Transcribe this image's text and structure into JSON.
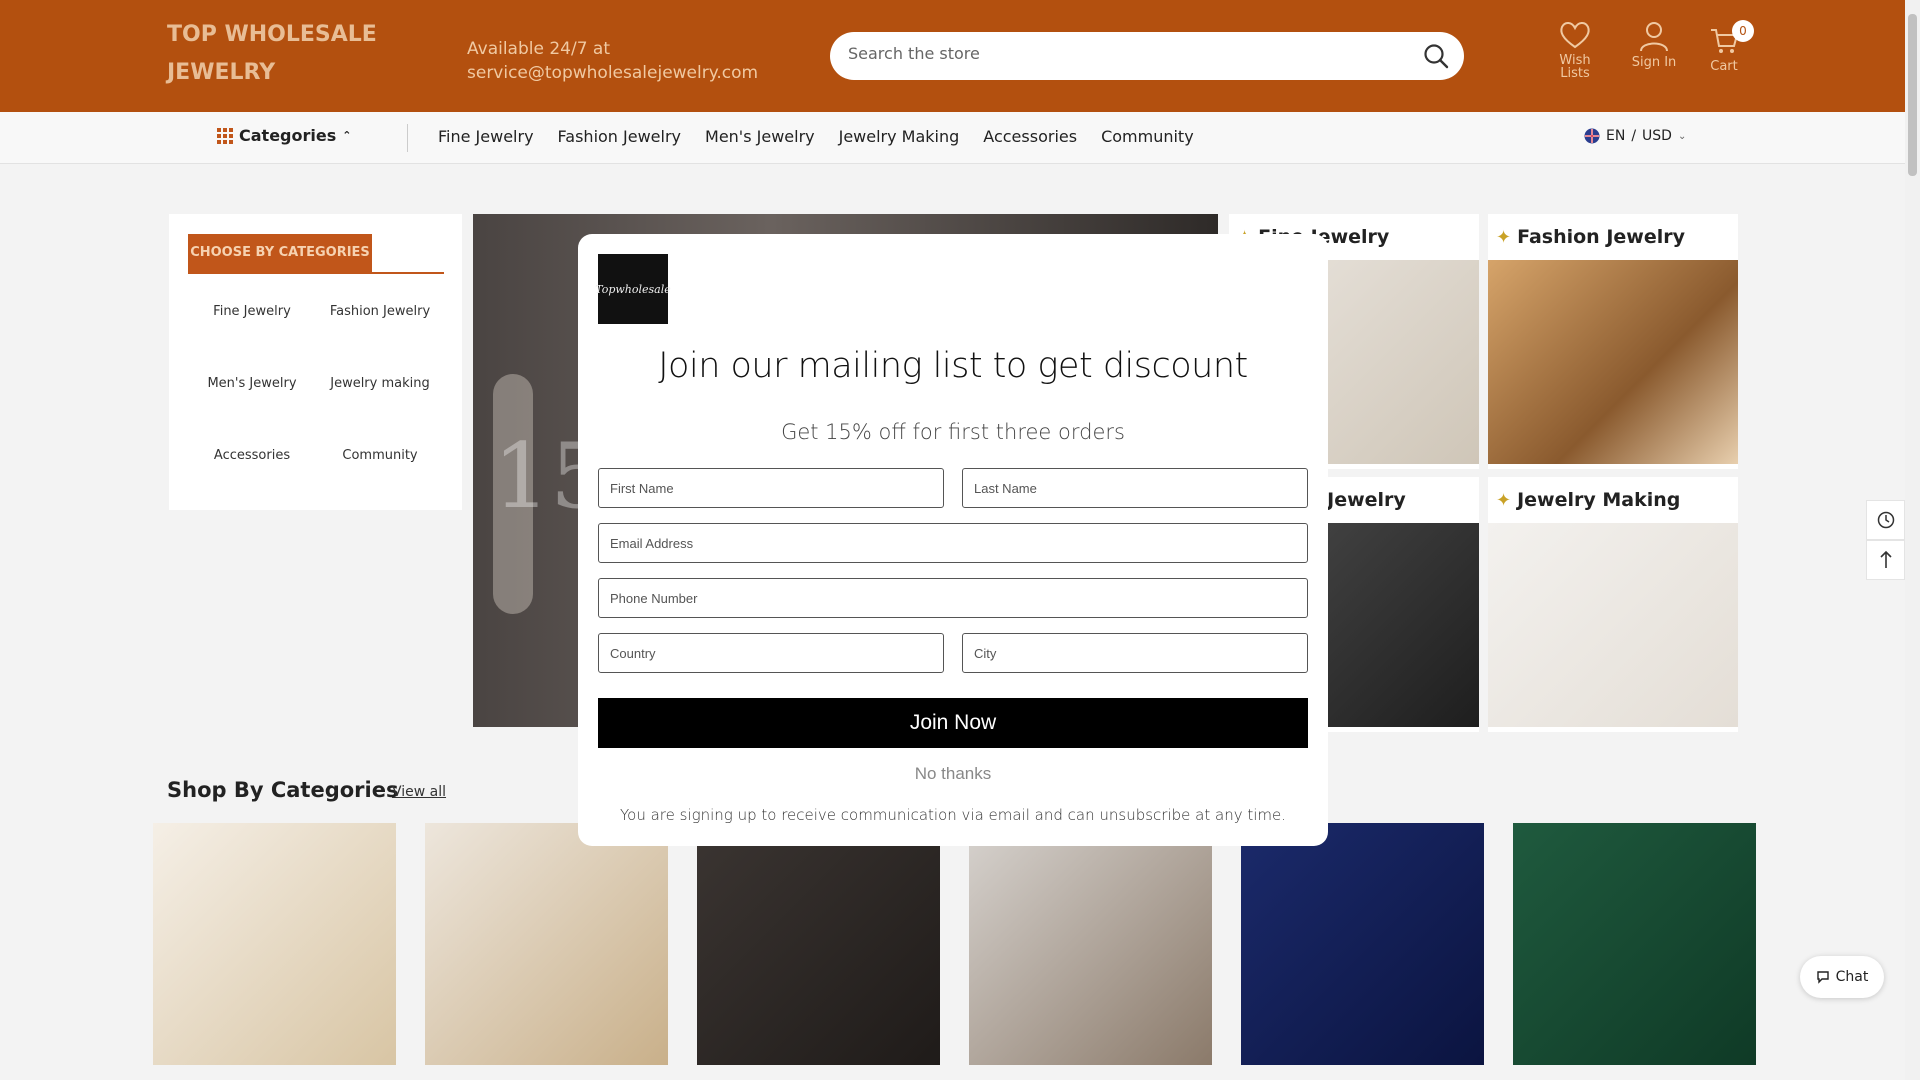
{
  "header": {
    "logo": "TOP WHOLESALE JEWELRY",
    "contact_line1": "Available 24/7 at",
    "contact_line2": "service@topwholesalejewelry.com",
    "search_placeholder": "Search the store",
    "wishlist_label": "Wish Lists",
    "signin_label": "Sign In",
    "cart_label": "Cart",
    "cart_count": "0"
  },
  "nav": {
    "categories_label": "Categories",
    "links": [
      "Fine Jewelry",
      "Fashion Jewelry",
      "Men's Jewelry",
      "Jewelry Making",
      "Accessories",
      "Community"
    ],
    "language": "EN",
    "currency": "USD"
  },
  "category_card": {
    "tab_label": "CHOOSE BY CATEGORIES",
    "items": [
      "Fine Jewelry",
      "Fashion Jewelry",
      "Men's Jewelry",
      "Jewelry making",
      "Accessories",
      "Community"
    ]
  },
  "hero": {
    "big_text": "15"
  },
  "tiles": [
    {
      "title": "Fine Jewelry"
    },
    {
      "title": "Fashion Jewelry"
    },
    {
      "title": "Men's Jewelry"
    },
    {
      "title": "Jewelry Making"
    }
  ],
  "shop": {
    "title": "Shop By Categories",
    "view_all": "View all"
  },
  "chat": {
    "label": "Chat"
  },
  "modal": {
    "logo_text": "Topwholesale",
    "title": "Join our mailing list to get discount",
    "subtitle": "Get 15% off for first three orders",
    "first_name_placeholder": "First Name",
    "last_name_placeholder": "Last Name",
    "email_placeholder": "Email Address",
    "phone_placeholder": "Phone Number",
    "country_placeholder": "Country",
    "city_placeholder": "City",
    "join_label": "Join Now",
    "no_thanks": "No thanks",
    "disclaimer": "You are signing up to receive communication via email and can unsubscribe at any time."
  },
  "colors": {
    "brand": "#b3500f",
    "accent_tab": "#c1561a",
    "join_button": "#000000"
  }
}
